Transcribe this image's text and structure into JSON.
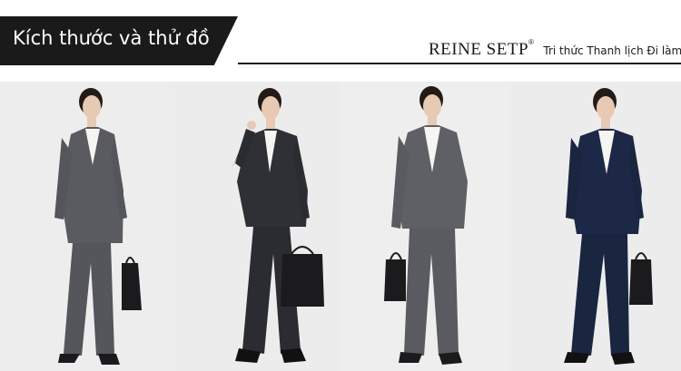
{
  "header": {
    "title": "Kích thước và thử đồ",
    "brand_name": "REINE SETP",
    "brand_mark": "®",
    "tagline": "Tri thức Thanh lịch Đi làm"
  },
  "models": [
    {
      "suit": "grey-suit",
      "color": "#5a5b60"
    },
    {
      "suit": "charcoal-pinstripe-suit",
      "color": "#2e3035"
    },
    {
      "suit": "grey-suit",
      "color": "#5f6065"
    },
    {
      "suit": "navy-suit",
      "color": "#1c2845"
    }
  ],
  "colors": {
    "banner": "#1a1a1a",
    "background": "#ececec",
    "shirt": "#f5f5f2",
    "skin": "#e8c9b4",
    "hair": "#241b17",
    "bag": "#1b1b1d"
  }
}
